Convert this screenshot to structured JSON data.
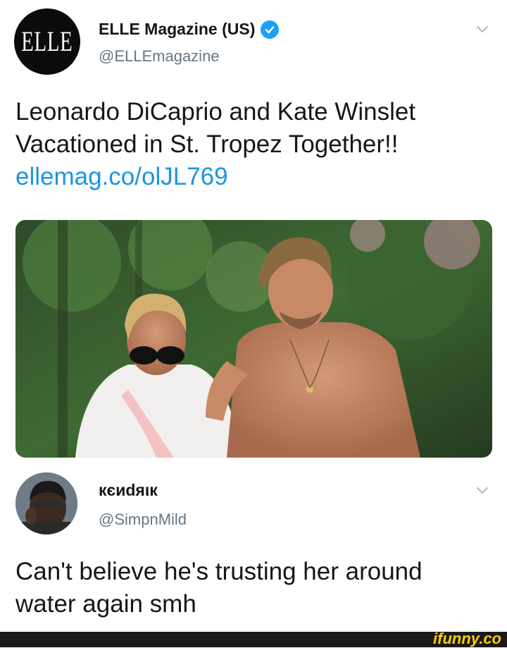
{
  "tweet1": {
    "avatar_text": "ELLE",
    "display_name": "ELLE Magazine (US)",
    "handle": "@ELLEmagazine",
    "text_line1": "Leonardo DiCaprio and Kate Winslet",
    "text_line2": "Vacationed in St. Tropez Together!!",
    "link": "ellemag.co/olJL769"
  },
  "tweet2": {
    "display_name": "кєиdяιк",
    "handle": "@SimpnMild",
    "text_line1": "Can't believe he's trusting her around",
    "text_line2": "water again smh"
  },
  "watermark": "ifunny.co",
  "colors": {
    "link": "#1b95e0",
    "verified": "#1da1f2",
    "handle": "#657786",
    "watermark": "#ffcc00"
  },
  "icons": [
    "verified-badge-icon",
    "chevron-down-icon"
  ]
}
